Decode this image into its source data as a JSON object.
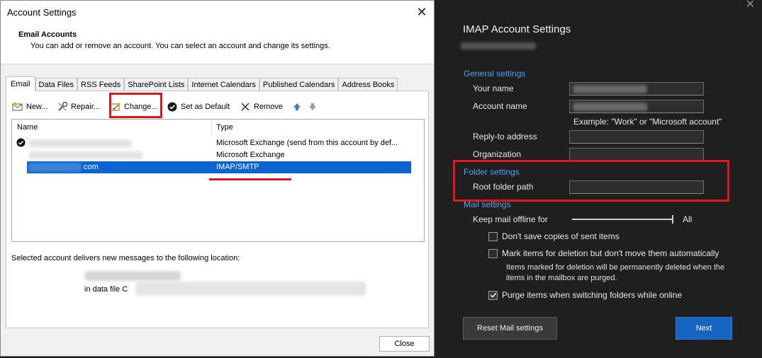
{
  "account_settings": {
    "window_title": "Account Settings",
    "close_glyph": "✕",
    "header": {
      "title": "Email Accounts",
      "subtitle": "You can add or remove an account. You can select an account and change its settings."
    },
    "tabs": [
      {
        "label": "Email"
      },
      {
        "label": "Data Files"
      },
      {
        "label": "RSS Feeds"
      },
      {
        "label": "SharePoint Lists"
      },
      {
        "label": "Internet Calendars"
      },
      {
        "label": "Published Calendars"
      },
      {
        "label": "Address Books"
      }
    ],
    "toolbar": {
      "new_label": "New...",
      "repair_label": "Repair...",
      "change_label": "Change...",
      "default_label": "Set as Default",
      "remove_label": "Remove"
    },
    "list": {
      "col_name": "Name",
      "col_type": "Type",
      "rows": [
        {
          "name_suffix": "",
          "type": "Microsoft Exchange (send from this account by def...",
          "default": true
        },
        {
          "name_suffix": "",
          "type": "Microsoft Exchange",
          "default": false
        },
        {
          "name_suffix": "com",
          "type": "IMAP/SMTP",
          "default": false,
          "selected": true
        }
      ]
    },
    "deliver_label": "Selected account delivers new messages to the following location:",
    "datafile_label": "in data file C",
    "close_button": "Close"
  },
  "imap_settings": {
    "title": "IMAP Account Settings",
    "close_glyph": "✕",
    "general_section": "General settings",
    "your_name_label": "Your name",
    "account_name_label": "Account name",
    "example_text": "Example: \"Work\" or \"Microsoft account\"",
    "reply_to_label": "Reply-to address",
    "organization_label": "Organization",
    "folder_section": "Folder settings",
    "root_folder_label": "Root folder path",
    "mail_section": "Mail settings",
    "keep_offline_label": "Keep mail offline for",
    "keep_offline_value": "All",
    "chk_dont_save": {
      "label": "Don't save copies of sent items",
      "checked": false
    },
    "chk_mark_delete": {
      "label": "Mark items for deletion but don't move them automatically",
      "checked": false
    },
    "purge_note": "Items marked for deletion will be permanently deleted when the items in the mailbox are purged.",
    "chk_purge": {
      "label": "Purge items when switching folders while online",
      "checked": true
    },
    "reset_button": "Reset Mail settings",
    "next_button": "Next"
  },
  "colors": {
    "highlight": "#e0161d",
    "selection": "#0a64d2",
    "link_blue": "#4ea3f0",
    "primary_button": "#1565c0"
  }
}
